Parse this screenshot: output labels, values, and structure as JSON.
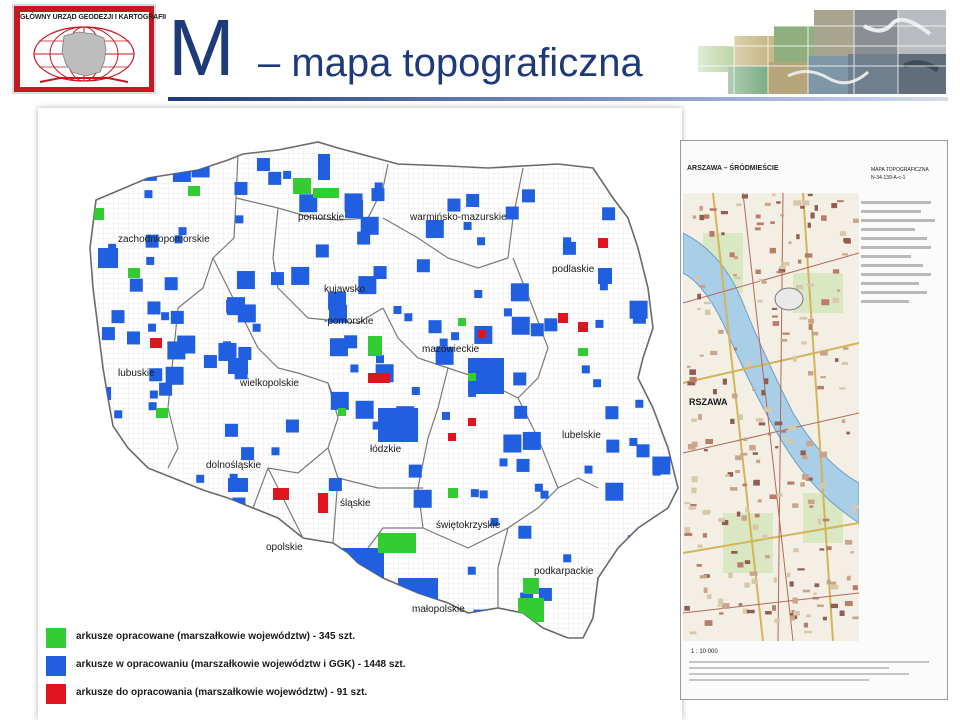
{
  "header": {
    "logo_text": "GŁÓWNY URZĄD GEODEZJI I KARTOGRAFII",
    "title_letter": "M",
    "title_text": "– mapa topograficzna"
  },
  "map": {
    "regions": [
      {
        "id": "pomorskie",
        "label": "pomorskie"
      },
      {
        "id": "warminsko-mazurskie",
        "label": "warmińsko-mazurskie"
      },
      {
        "id": "zachodniopomorskie",
        "label": "zachodniopomorskie"
      },
      {
        "id": "podlaskie",
        "label": "podlaskie"
      },
      {
        "id": "kujawsko-pomorskie-1",
        "label": "kujawsko"
      },
      {
        "id": "kujawsko-pomorskie-2",
        "label": "-pomorskie"
      },
      {
        "id": "mazowieckie",
        "label": "mazowieckie"
      },
      {
        "id": "lubuskie",
        "label": "lubuskie"
      },
      {
        "id": "wielkopolskie",
        "label": "wielkopolskie"
      },
      {
        "id": "lodzkie",
        "label": "łódzkie"
      },
      {
        "id": "lubelskie",
        "label": "lubelskie"
      },
      {
        "id": "dolnoslaskie",
        "label": "dolnośląskie"
      },
      {
        "id": "slaskie",
        "label": "śląskie"
      },
      {
        "id": "swietokrzyskie",
        "label": "świętokrzyskie"
      },
      {
        "id": "opolskie",
        "label": "opolskie"
      },
      {
        "id": "podkarpackie",
        "label": "podkarpackie"
      },
      {
        "id": "malopolskie",
        "label": "małopolskie"
      }
    ],
    "legend": [
      {
        "color": "#33cc33",
        "label": "arkusze opracowane (marszałkowie województw) - 345 szt."
      },
      {
        "color": "#1f5fe0",
        "label": "arkusze w opracowaniu (marszałkowie województw i GGK) - 1448 szt."
      },
      {
        "color": "#e0141e",
        "label": "arkusze do opracowania (marszałkowie województw) - 91 szt."
      }
    ],
    "colors": {
      "completed": "#33cc33",
      "in_progress": "#1f5fe0",
      "to_do": "#e0141e"
    }
  },
  "topo_sheet": {
    "header_left": "ARSZAWA – ŚRÓDMIEŚCIE",
    "header_right": "MAPA TOPOGRAFICZNA",
    "sheet_id": "N-34-139-A-c-1",
    "map_label": "RSZAWA",
    "scale": "1 : 10 000"
  }
}
